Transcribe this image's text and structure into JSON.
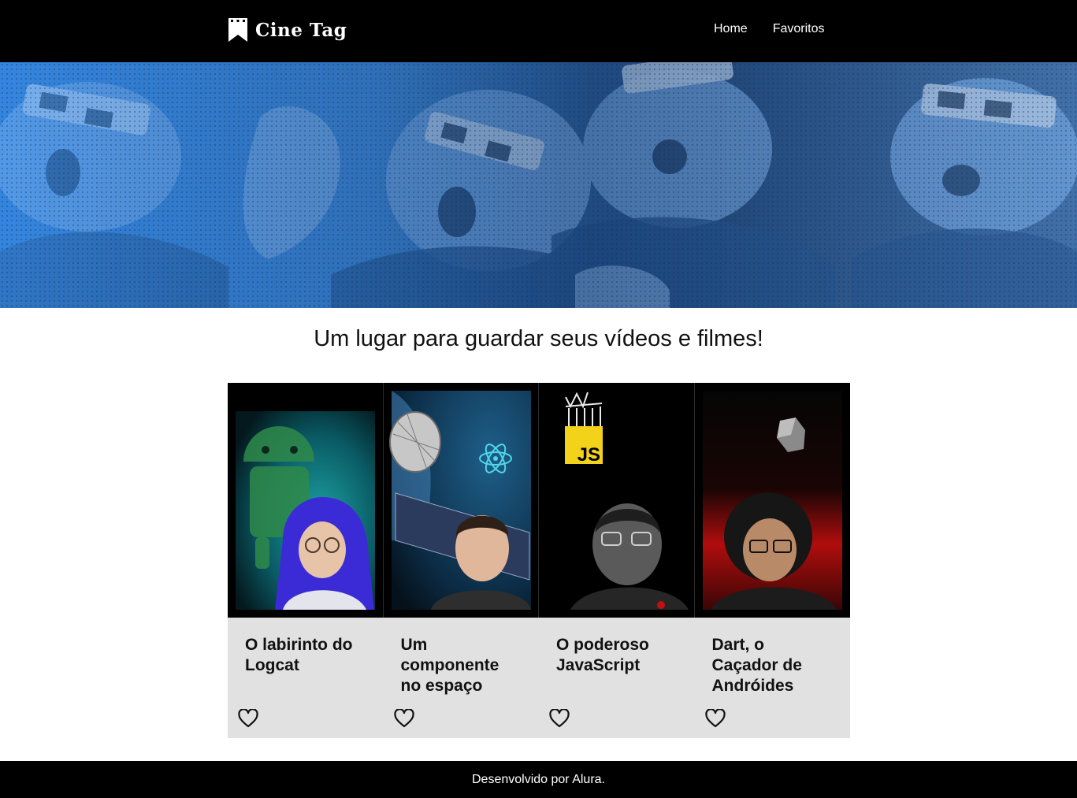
{
  "header": {
    "logo_text": "Cine Tag",
    "logo_icon": "film-bookmark-icon",
    "nav": [
      {
        "label": "Home"
      },
      {
        "label": "Favoritos"
      }
    ]
  },
  "banner": {
    "image": "3d-cinema-audience-photo",
    "tint": "#2f7fd8"
  },
  "main": {
    "subtitle": "Um lugar para guardar seus vídeos e filmes!"
  },
  "cards": [
    {
      "title": "O labirinto do Logcat",
      "thumb_theme": "android-teal",
      "fav_icon": "heart-outline-icon"
    },
    {
      "title": "Um componente no espaço",
      "thumb_theme": "react-space",
      "fav_icon": "heart-outline-icon"
    },
    {
      "title": "O poderoso JavaScript",
      "thumb_theme": "javascript-dark",
      "thumb_badge": "JS",
      "fav_icon": "heart-outline-icon"
    },
    {
      "title": "Dart, o Caçador de Andróides",
      "thumb_theme": "dart-red",
      "fav_icon": "heart-outline-icon"
    }
  ],
  "footer": {
    "text": "Desenvolvido por Alura."
  },
  "colors": {
    "header_bg": "#000000",
    "card_body_bg": "#e1e1e1",
    "banner_blue": "#2f7fd8",
    "js_yellow": "#f3d21a",
    "dart_red": "#c01010"
  }
}
